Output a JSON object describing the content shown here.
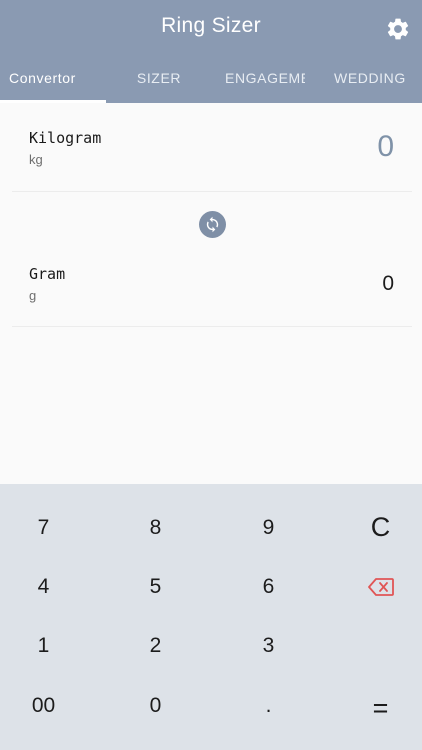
{
  "header": {
    "title": "Ring Sizer",
    "settings_icon": "gear-icon"
  },
  "tabs": [
    {
      "label": "Convertor",
      "active": true
    },
    {
      "label": "SIZER",
      "active": false
    },
    {
      "label": "ENGAGEMENT",
      "active": false
    },
    {
      "label": "WEDDING",
      "active": false
    }
  ],
  "converter": {
    "from": {
      "name": "Kilogram",
      "abbr": "kg",
      "value": "0"
    },
    "swap_icon": "sync-icon",
    "to": {
      "name": "Gram",
      "abbr": "g",
      "value": "0"
    }
  },
  "keypad": {
    "rows": [
      [
        "7",
        "8",
        "9",
        "C"
      ],
      [
        "4",
        "5",
        "6",
        "backspace"
      ],
      [
        "1",
        "2",
        "3",
        ""
      ],
      [
        "00",
        "0",
        ".",
        "="
      ]
    ],
    "backspace_icon": "backspace-icon"
  },
  "colors": {
    "header_bg": "#8a9ab2",
    "accent_value": "#7f92a8",
    "backspace_red": "#e05555",
    "keypad_bg": "#dde2e8"
  }
}
